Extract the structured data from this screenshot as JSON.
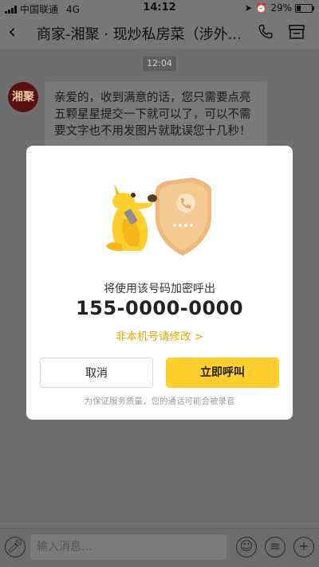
{
  "status_bar": {
    "carrier": "中国联通",
    "network": "4G",
    "time": "14:12",
    "battery": "29%"
  },
  "nav": {
    "back_icon": "chevron-left-icon",
    "title": "商家-湘聚 · 现炒私房菜（涉外...",
    "phone_icon": "phone-icon",
    "shop_icon": "store-icon"
  },
  "chat": {
    "timestamp": "12:04",
    "avatar_text": "湘聚",
    "message": "亲爱的，收到满意的话，您只需要点亮五颗星星提交一下就可以了，可以不需要文字也不用发图片就耽误您十几秒！"
  },
  "dialog": {
    "description": "将使用该号码加密呼出",
    "phone_number": "155-0000-0000",
    "change_link": "非本机号请修改 >",
    "cancel_label": "取消",
    "call_label": "立即呼叫",
    "note": "为保证服务质量，您的通话可能会被录音",
    "accent_color": "#ffcf2e"
  },
  "input_bar": {
    "placeholder": "输入消息..."
  }
}
